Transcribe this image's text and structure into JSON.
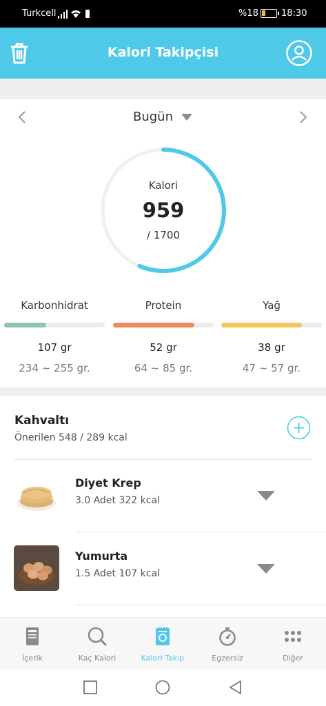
{
  "status": {
    "carrier": "Turkcell",
    "battery": "%18",
    "time": "18:30"
  },
  "header": {
    "title": "Kalori Takipçisi"
  },
  "date_nav": {
    "label": "Bugün"
  },
  "calories": {
    "label": "Kalori",
    "value": "959",
    "goal": "/ 1700",
    "progress": 0.564
  },
  "macros": [
    {
      "name": "Karbonhidrat",
      "grams": "107 gr",
      "range": "234 ~ 255 gr.",
      "color": "#8fc3b4",
      "progress": 0.42
    },
    {
      "name": "Protein",
      "grams": "52 gr",
      "range": "64 ~ 85 gr.",
      "color": "#f08a5d",
      "progress": 0.81
    },
    {
      "name": "Yağ",
      "grams": "38 gr",
      "range": "47 ~ 57 gr.",
      "color": "#f6c65b",
      "progress": 0.8
    }
  ],
  "meal": {
    "title": "Kahvaltı",
    "subtitle": "Önerilen 548 / 289 kcal",
    "items": [
      {
        "name": "Diyet Krep",
        "detail": "3.0 Adet 322 kcal"
      },
      {
        "name": "Yumurta",
        "detail": "1.5 Adet 107 kcal"
      }
    ]
  },
  "bottom_nav": [
    {
      "label": "İçerik",
      "icon": "book-icon"
    },
    {
      "label": "Kaç Kalori",
      "icon": "search-icon"
    },
    {
      "label": "Kalori Takip",
      "icon": "tracker-icon"
    },
    {
      "label": "Egzersiz",
      "icon": "stopwatch-icon"
    },
    {
      "label": "Diğer",
      "icon": "more-icon"
    }
  ],
  "colors": {
    "accent": "#4ec9e8",
    "ring_track": "#f0f0f0",
    "nav_inactive": "#888888"
  }
}
